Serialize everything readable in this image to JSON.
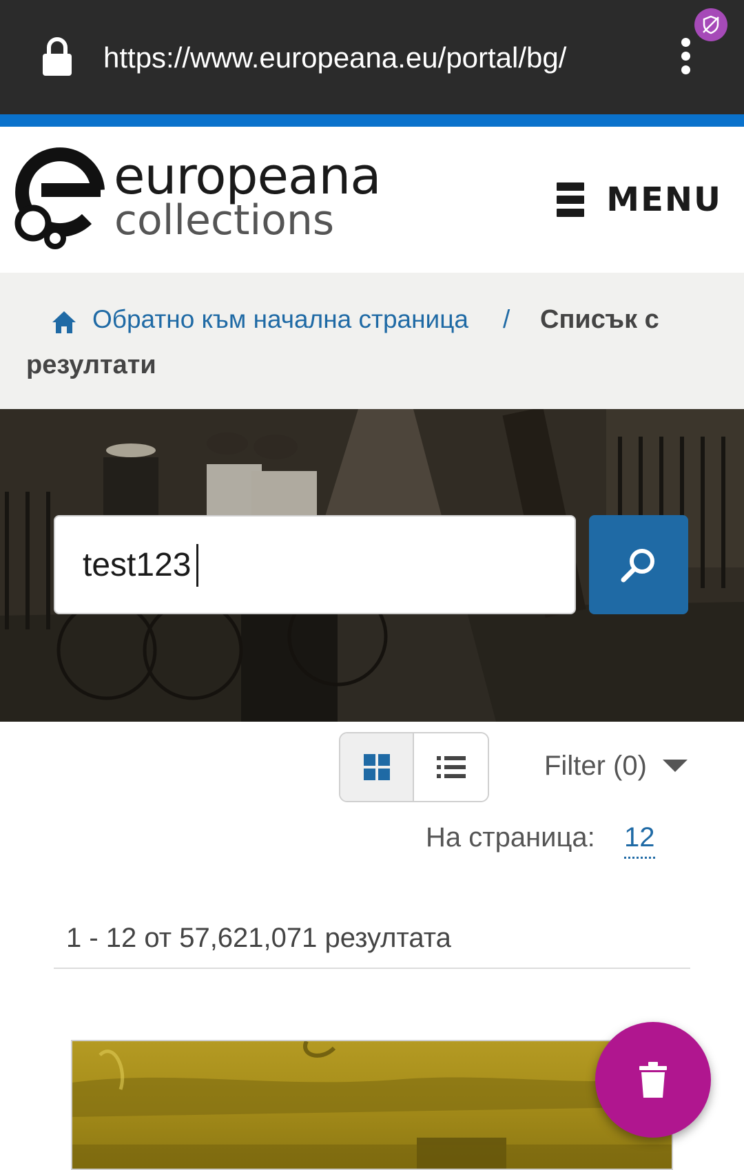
{
  "browser": {
    "url": "https://www.europeana.eu/portal/bg/"
  },
  "header": {
    "logo_line1": "europeana",
    "logo_line2": "collections",
    "menu_label": "MENU"
  },
  "breadcrumb": {
    "home_label": "Обратно към начална страница",
    "separator": "/",
    "current_line1": "Списък с",
    "current_line2": "резултати"
  },
  "search": {
    "value": "test123"
  },
  "results": {
    "filter_label": "Filter (0)",
    "per_page_label": "На страница:",
    "per_page_value": "12",
    "count_text": "1 - 12 от 57,621,071 резултата"
  },
  "colors": {
    "brand_blue": "#1f6aa5",
    "fab_magenta": "#b0168f"
  }
}
